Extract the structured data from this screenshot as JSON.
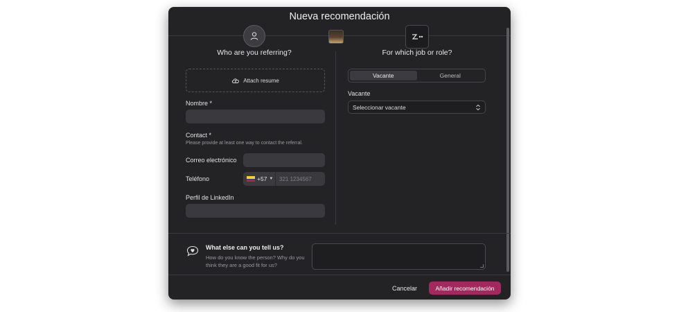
{
  "modal": {
    "title": "Nueva recomendación"
  },
  "left": {
    "title": "Who are you referring?",
    "attach_label": "Attach resume",
    "nombre_label": "Nombre *",
    "contact_label": "Contact *",
    "contact_hint": "Please provide at least one way to contact the referral.",
    "email_label": "Correo electrónico",
    "phone_label": "Teléfono",
    "phone_code": "+57",
    "phone_placeholder": "321 1234567",
    "linkedin_label": "Perfil de LinkedIn"
  },
  "right": {
    "title": "For which job or role?",
    "tabs": [
      "Vacante",
      "General"
    ],
    "vacante_label": "Vacante",
    "select_value": "Seleccionar vacante"
  },
  "footer": {
    "tell_title": "What else can you tell us?",
    "tell_hint": "How do you know the person? Why do you think they are a good fit for us?",
    "cancel_label": "Cancelar",
    "add_label": "Añadir recomendación"
  },
  "icons": {
    "avatar": "user-icon",
    "attach": "cloud-upload-icon",
    "chat": "heart-chat-icon",
    "select": "chevron-up-down-icon",
    "phone_caret": "caret-down-icon"
  },
  "colors": {
    "modal_bg": "#232325",
    "accent": "#a3285d",
    "input_bg": "#3a3a3e"
  }
}
